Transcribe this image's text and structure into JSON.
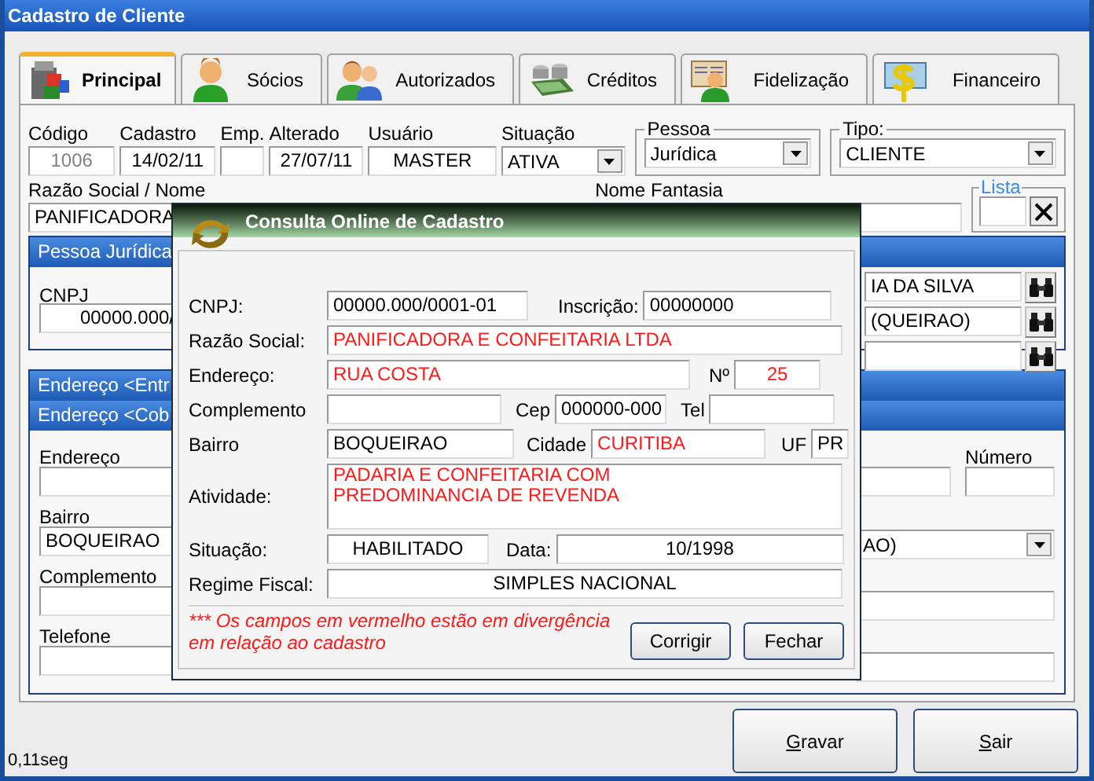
{
  "window": {
    "title": "Cadastro de Cliente"
  },
  "tabs": [
    {
      "label": "Principal",
      "selected": true
    },
    {
      "label": "Sócios",
      "selected": false
    },
    {
      "label": "Autorizados",
      "selected": false
    },
    {
      "label": "Créditos",
      "selected": false
    },
    {
      "label": "Fidelização",
      "selected": false
    },
    {
      "label": "Financeiro",
      "selected": false
    }
  ],
  "header_fields": [
    {
      "label": "Código",
      "value": "1006",
      "kind": "text",
      "disabled": true
    },
    {
      "label": "Cadastro",
      "value": "14/02/11",
      "kind": "text",
      "disabled": false
    },
    {
      "label": "Emp.",
      "kind": "text"
    },
    {
      "label": "Alterado",
      "value": "27/07/11",
      "kind": "text",
      "disabled": false
    },
    {
      "label": "Usuário",
      "value": "MASTER",
      "kind": "text",
      "disabled": false
    },
    {
      "label": "Situação",
      "value": "ATIVA",
      "kind": "combo"
    }
  ],
  "pessoa": {
    "title": "Pessoa",
    "value": "Jurídica"
  },
  "tipo": {
    "title": "Tipo:",
    "value": "CLIENTE"
  },
  "razao_social": {
    "label": "Razão Social / Nome",
    "value": "PANIFICADORA"
  },
  "nome_fantasia": {
    "label": "Nome Fantasia"
  },
  "lista": {
    "title": "Lista"
  },
  "pessoa_juridica": {
    "title": "Pessoa Jurídica",
    "cnpj_label": "CNPJ",
    "cnpj_value": "00000.000/",
    "lookups": [
      {
        "kind": "lookup",
        "value": "IA DA SILVA"
      },
      {
        "kind": "lookup",
        "value": "(QUEIRAO)"
      },
      {
        "kind": "lookup"
      }
    ]
  },
  "address_sections": [
    {
      "title": "Endereço <Entr"
    },
    {
      "title": "Endereço <Cob"
    }
  ],
  "address_fields": [
    {
      "label": "Endereço"
    },
    {
      "label": "Bairro",
      "value": "BOQUEIRAO"
    },
    {
      "label": "Complemento"
    },
    {
      "label": "Telefone"
    }
  ],
  "numero": {
    "label": "Número"
  },
  "address_combo": {
    "value": "AO)"
  },
  "dialog": {
    "title": "Consulta Online de Cadastro",
    "rows": [
      [
        {
          "kind": "text",
          "label": "CNPJ:",
          "value": "00000.000/0001-01",
          "divergent": false
        },
        {
          "kind": "text",
          "label": "Inscrição:",
          "value": "00000000",
          "divergent": false
        }
      ],
      [
        {
          "kind": "text",
          "label": "Razão Social:",
          "value": "PANIFICADORA E CONFEITARIA LTDA",
          "divergent": true
        }
      ],
      [
        {
          "kind": "text",
          "label": "Endereço:",
          "value": "RUA COSTA",
          "divergent": true
        },
        {
          "kind": "centered",
          "label": "Nº",
          "value": "25",
          "divergent": true
        }
      ],
      [
        {
          "kind": "text",
          "label": "Complemento"
        },
        {
          "kind": "text",
          "label": "Cep",
          "value": "000000-000",
          "divergent": false
        },
        {
          "kind": "text",
          "label": "Tel"
        }
      ],
      [
        {
          "kind": "text",
          "label": "Bairro",
          "value": "BOQUEIRAO",
          "divergent": false
        },
        {
          "kind": "text",
          "label": "Cidade",
          "value": "CURITIBA",
          "divergent": true
        },
        {
          "kind": "text",
          "label": "UF",
          "value": "PR",
          "divergent": false
        }
      ],
      [
        {
          "kind": "multiline",
          "label": "Atividade:",
          "value": "PADARIA E CONFEITARIA COM\nPREDOMINANCIA DE REVENDA",
          "divergent": true
        }
      ],
      [
        {
          "kind": "centered",
          "label": "Situação:",
          "value": "HABILITADO",
          "divergent": false
        },
        {
          "kind": "centered",
          "label": "Data:",
          "value": "10/1998",
          "divergent": false
        }
      ],
      [
        {
          "kind": "centered",
          "label": "Regime Fiscal:",
          "value": "SIMPLES NACIONAL",
          "divergent": false
        }
      ]
    ],
    "note": "*** Os campos em vermelho estão em divergência em relação ao cadastro",
    "buttons": [
      {
        "label": "Corrigir"
      },
      {
        "label": "Fechar"
      }
    ]
  },
  "buttons": [
    {
      "label": "Gravar"
    },
    {
      "label": "Sair"
    }
  ],
  "status_bar": "0,11seg"
}
